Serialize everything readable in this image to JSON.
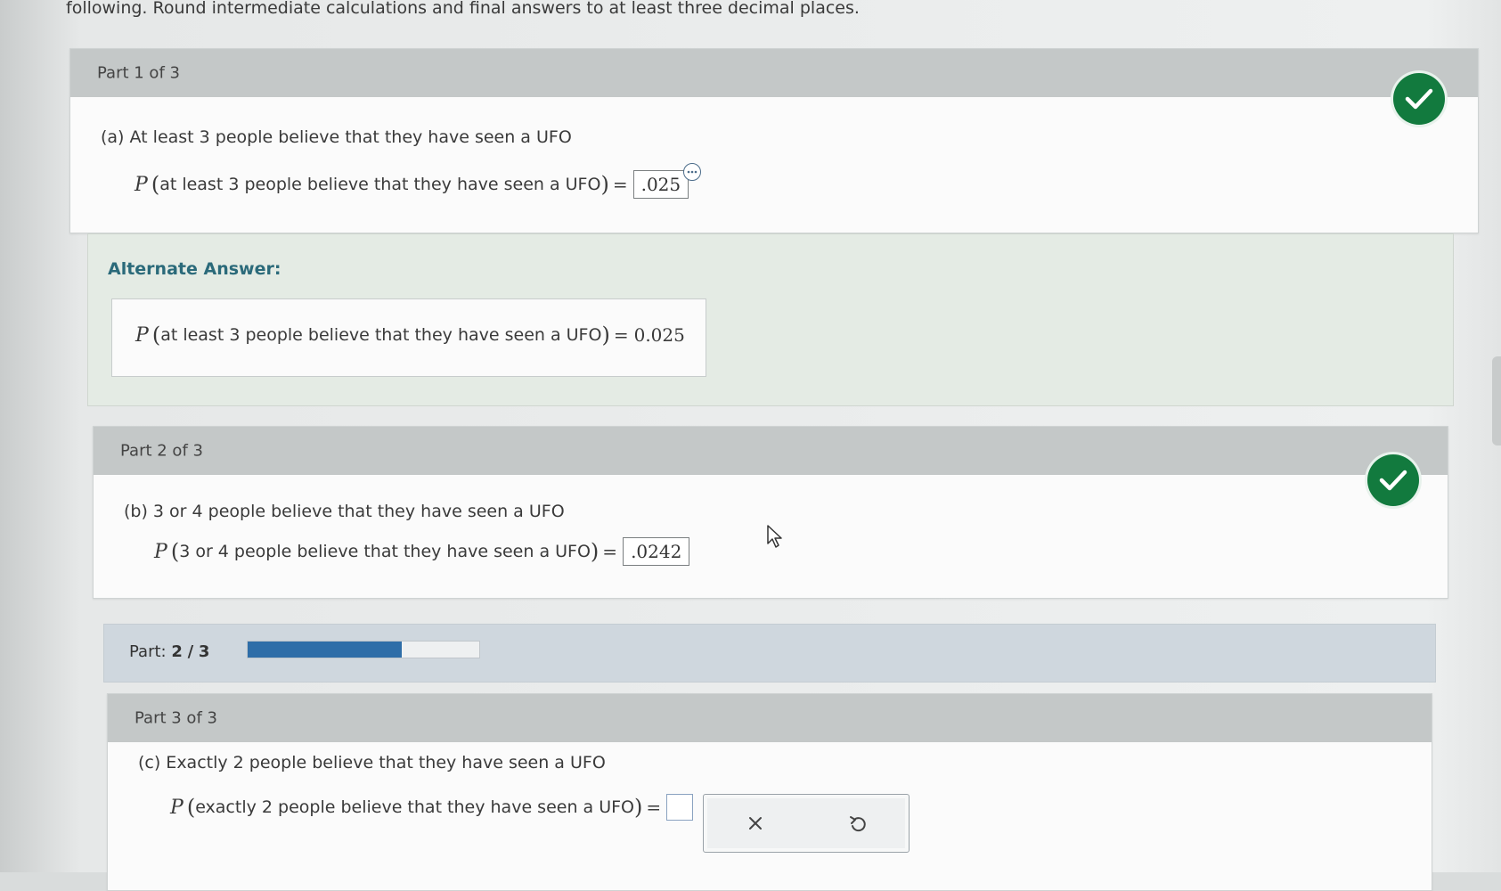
{
  "instructions": "following. Round intermediate calculations and final answers to at least three decimal places.",
  "part1": {
    "header": "Part 1 of 3",
    "question": "(a) At least 3 people believe that they have seen a UFO",
    "eq_p": "P",
    "eq_text": "at least 3 people believe that they have seen a UFO",
    "answer": ".025",
    "status_icon": "check-circle-icon",
    "status_color": "#127a3e"
  },
  "alternate": {
    "title": "Alternate Answer:",
    "eq_p": "P",
    "eq_text": "at least 3 people believe that they have seen a UFO",
    "value": "0.025"
  },
  "part2": {
    "header": "Part 2 of 3",
    "question": "(b) 3 or 4 people believe that they have seen a UFO",
    "eq_p": "P",
    "eq_text": "3 or 4 people believe that they have seen a UFO",
    "answer": ".0242",
    "status_icon": "check-circle-icon"
  },
  "progress": {
    "label": "Part:",
    "current": "2",
    "separator": "/",
    "total": "3",
    "fraction": 0.667,
    "fill_color": "#2f6ea8"
  },
  "part3": {
    "header": "Part 3 of 3",
    "question": "(c) Exactly 2 people believe that they have seen a UFO",
    "eq_p": "P",
    "eq_text": "exactly 2 people believe that they have seen a UFO",
    "answer": "",
    "clear_icon": "x-icon",
    "undo_icon": "undo-icon"
  }
}
